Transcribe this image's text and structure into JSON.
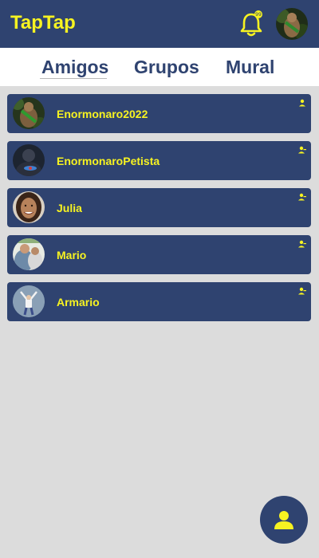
{
  "header": {
    "title": "TapTap",
    "notification_icon": "bell-icon",
    "profile_avatar": "profile-avatar"
  },
  "tabs": [
    {
      "label": "Amigos",
      "active": true
    },
    {
      "label": "Grupos",
      "active": false
    },
    {
      "label": "Mural",
      "active": false
    }
  ],
  "friends": [
    {
      "name": "Enormonaro2022",
      "status_icon": "person-icon"
    },
    {
      "name": "EnormonaroPetista",
      "status_icon": "person-remove-icon"
    },
    {
      "name": "Julia",
      "status_icon": "person-remove-icon"
    },
    {
      "name": "Mario",
      "status_icon": "person-remove-icon"
    },
    {
      "name": "Armario",
      "status_icon": "person-remove-icon"
    }
  ],
  "fab": {
    "icon": "person-icon"
  },
  "colors": {
    "header_bg": "#2f4370",
    "accent_yellow": "#f7f321",
    "page_bg": "#dcdcdc"
  }
}
